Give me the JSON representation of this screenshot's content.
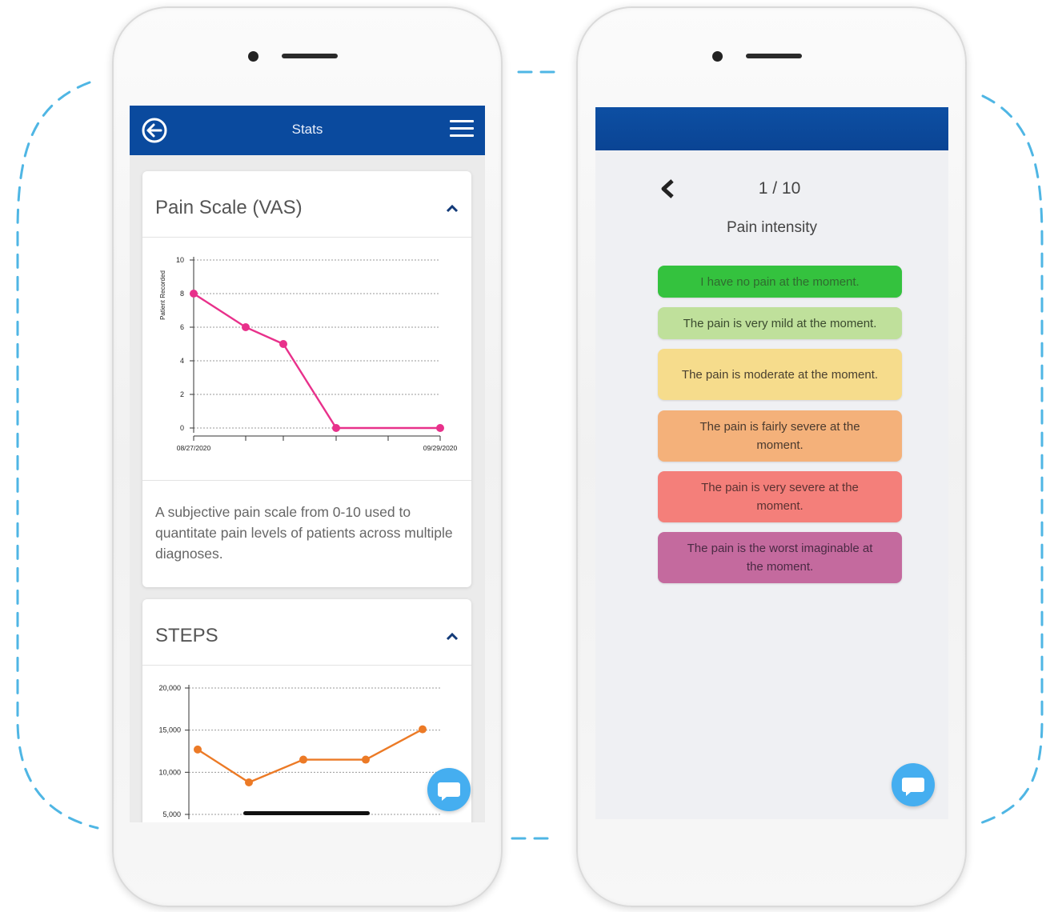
{
  "colors": {
    "dash": "#4fb6e4",
    "appbar": "#0a4a9e",
    "pain_line": "#e8318b",
    "steps_line": "#ec7a26",
    "chat": "#45aef0"
  },
  "stats_screen": {
    "title": "Stats",
    "back_icon": "back-circle-arrow-icon",
    "menu_icon": "hamburger-menu-icon",
    "pain_card": {
      "title": "Pain Scale (VAS)",
      "description": "A subjective pain scale from 0-10 used to quantitate pain levels of patients across multiple diagnoses."
    },
    "steps_card": {
      "title": "STEPS"
    }
  },
  "chart_data": [
    {
      "type": "line",
      "ylabel": "Patient Recorded",
      "ylim": [
        0,
        10
      ],
      "yticks": [
        "10",
        "8",
        "6",
        "4",
        "2",
        "0"
      ],
      "xtick_labels": [
        "08/27/2020",
        "09/29/2020"
      ],
      "series": [
        {
          "values": [
            8,
            6,
            5,
            0,
            0
          ]
        }
      ],
      "grid": true,
      "color": "#e8318b"
    },
    {
      "type": "line",
      "ylim": [
        5000,
        20000
      ],
      "yticks": [
        "20,000",
        "15,000",
        "10,000",
        "5,000"
      ],
      "series": [
        {
          "values": [
            12700,
            8800,
            11500,
            11500,
            15100
          ]
        }
      ],
      "grid": true,
      "color": "#ec7a26"
    }
  ],
  "question_screen": {
    "counter": "1 / 10",
    "title": "Pain intensity",
    "options": [
      {
        "label": "I have no pain at the moment.",
        "color": "#34c23e",
        "text_color": "#2f6b2f"
      },
      {
        "label": "The pain is very mild at the moment.",
        "color": "#bfe09b",
        "text_color": "#3a4a2e"
      },
      {
        "label": "The pain is moderate at the moment.",
        "color": "#f6dc8c",
        "text_color": "#4a4030"
      },
      {
        "label": "The pain is fairly severe at the moment.",
        "color": "#f4b17a",
        "text_color": "#4a3a2e"
      },
      {
        "label": "The pain is very severe at the moment.",
        "color": "#f47f7a",
        "text_color": "#5a3232"
      },
      {
        "label": "The pain is the worst imaginable at the moment.",
        "color": "#c46a9e",
        "text_color": "#4a2a44"
      }
    ]
  }
}
